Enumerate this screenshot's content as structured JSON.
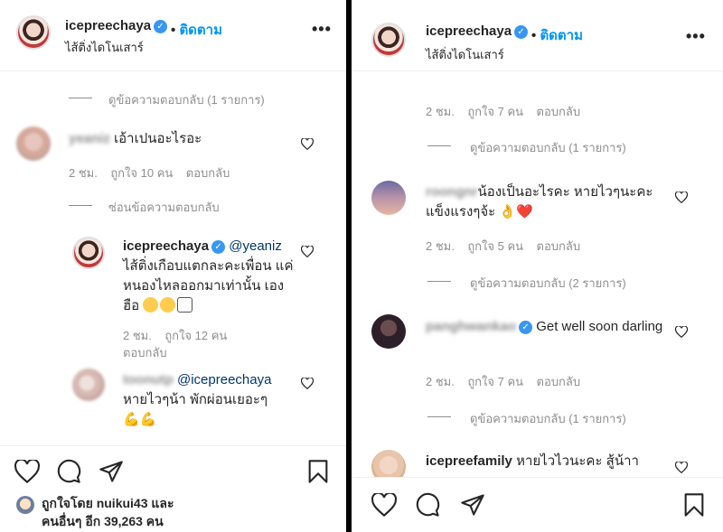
{
  "left": {
    "header": {
      "username": "icepreechaya",
      "follow": "ติดตาม",
      "subtitle": "ไส้ติ่งไดโนเสาร์",
      "dot": "•"
    },
    "view_replies_1": "ดูข้อความตอบกลับ (1 รายการ)",
    "comment1": {
      "user": "yeaniz",
      "text": "เอ้าเปนอะไรอะ",
      "time": "2 ชม.",
      "likes": "ถูกใจ 10 คน",
      "reply": "ตอบกลับ"
    },
    "hide_replies": "ซ่อนข้อความตอบกลับ",
    "reply1": {
      "user": "icepreechaya",
      "mention": "@yeaniz",
      "text": "ไส้ติ่งเกือบแตกละคะเพื่อน แค่หนองไหลออกมาเท่านั้น เอง ฮือ",
      "time": "2 ชม.",
      "likes": "ถูกใจ 12 คน",
      "reply": "ตอบกลับ"
    },
    "reply2": {
      "user": "toonutp",
      "mention": "@icepreechaya",
      "text": "หายไวๆน้า พักผ่อนเยอะๆ",
      "emoji": "💪💪"
    },
    "footer": {
      "liked_by": "ถูกใจโดย",
      "liker": "nuikui43",
      "and": "และ",
      "others": "คนอื่นๆ อีก 39,263 คน"
    }
  },
  "right": {
    "header": {
      "username": "icepreechaya",
      "follow": "ติดตาม",
      "subtitle": "ไส้ติ่งไดโนเสาร์",
      "dot": "•"
    },
    "meta_top": {
      "time": "2 ชม.",
      "likes": "ถูกใจ 7 คน",
      "reply": "ตอบกลับ"
    },
    "view_replies_1": "ดูข้อความตอบกลับ (1 รายการ)",
    "comment1": {
      "user": "roongnr",
      "text": "น้องเป็นอะไรคะ หายไวๆนะคะ แข็งแรงๆจ้ะ",
      "emoji": "👌❤️",
      "time": "2 ชม.",
      "likes": "ถูกใจ 5 คน",
      "reply": "ตอบกลับ"
    },
    "view_replies_2": "ดูข้อความตอบกลับ (2 รายการ)",
    "comment2": {
      "user": "panghwankao",
      "text": "Get well soon darling",
      "time": "2 ชม.",
      "likes": "ถูกใจ 7 คน",
      "reply": "ตอบกลับ"
    },
    "view_replies_3": "ดูข้อความตอบกลับ (1 รายการ)",
    "comment3": {
      "user": "icepreefamily",
      "text": "หายไวไวนะคะ สู้น้าา"
    }
  },
  "colors": {
    "link": "#0095f6",
    "muted": "#8e8e8e",
    "text": "#262626",
    "verified": "#3897f0"
  },
  "icons": [
    "more-icon",
    "heart-icon",
    "comment-icon",
    "share-icon",
    "bookmark-icon",
    "verified-icon"
  ]
}
